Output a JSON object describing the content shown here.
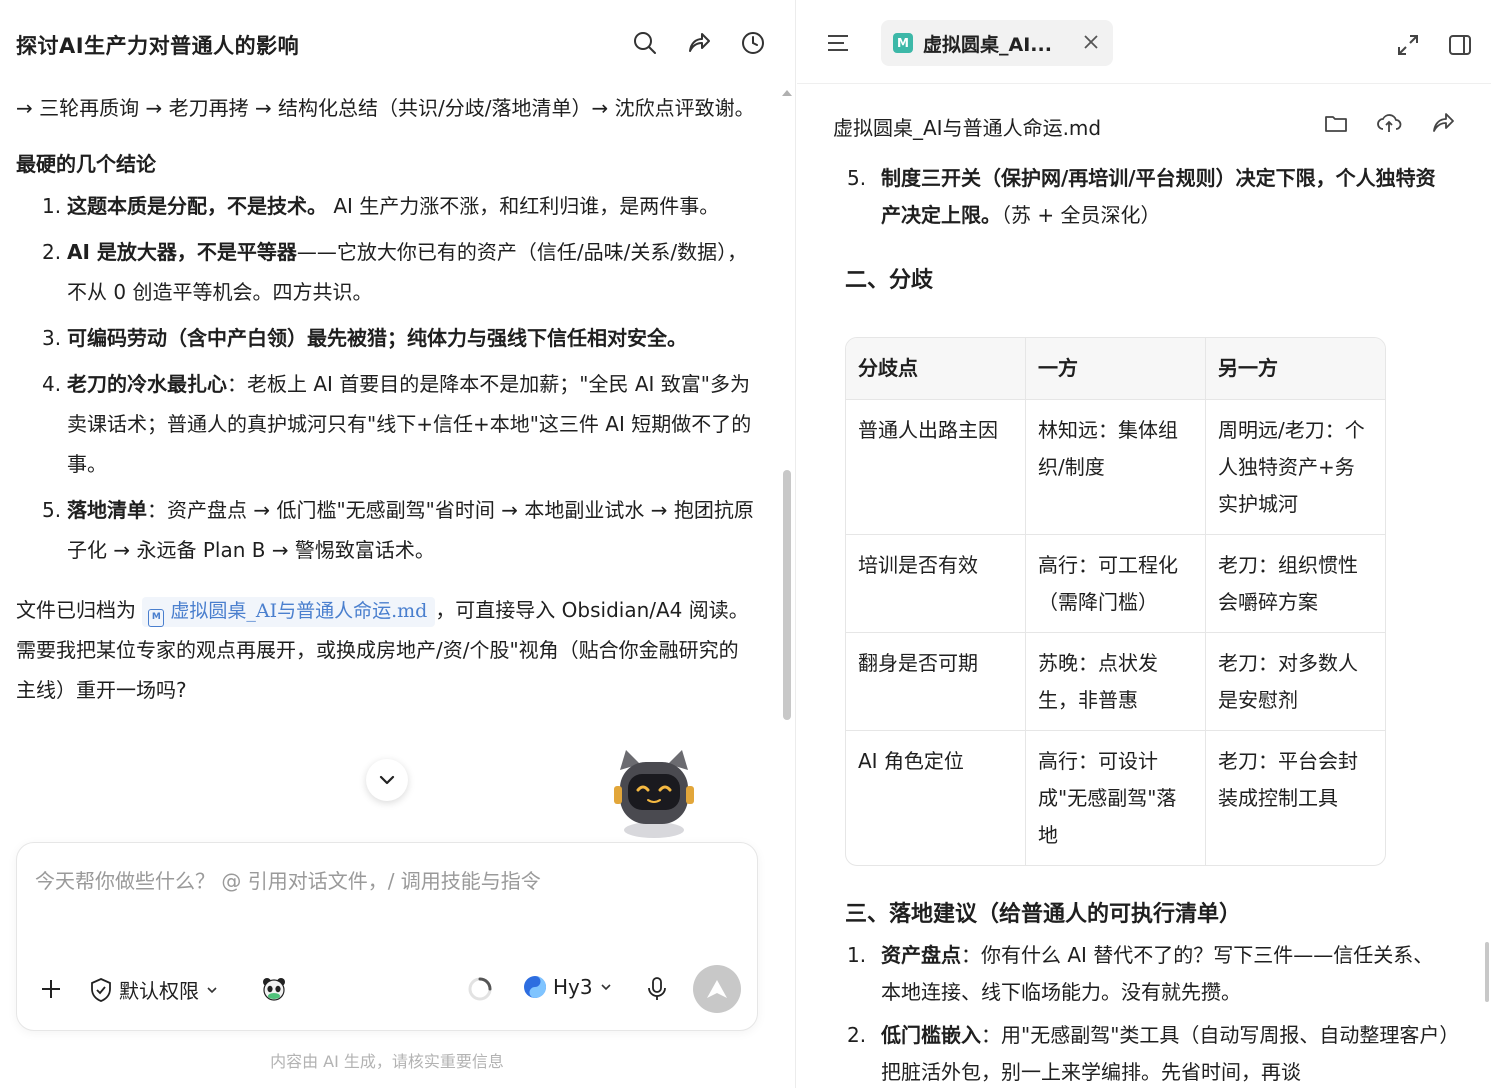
{
  "left": {
    "title": "探讨AI生产力对普通人的影响",
    "intro_text": "→ 三轮再质询 → 老刀再拷 → 结构化总结（共识/分歧/落地清单）→ 沈欣点评致谢。",
    "section_heading": "最硬的几个结论",
    "conclusions": [
      {
        "num": "1.",
        "bold": "这题本质是分配，不是技术。",
        "rest": " AI 生产力涨不涨，和红利归谁，是两件事。"
      },
      {
        "num": "2.",
        "bold": "AI 是放大器，不是平等器",
        "rest": "——它放大你已有的资产（信任/品味/关系/数据），不从 0 创造平等机会。四方共识。"
      },
      {
        "num": "3.",
        "bold": "可编码劳动（含中产白领）最先被猎；纯体力与强线下信任相对安全。",
        "rest": ""
      },
      {
        "num": "4.",
        "bold": "老刀的冷水最扎心",
        "rest": "：老板上 AI 首要目的是降本不是加薪；\"全民 AI 致富\"多为卖课话术；普通人的真护城河只有\"线下+信任+本地\"这三件 AI 短期做不了的事。"
      },
      {
        "num": "5.",
        "bold": "落地清单",
        "rest": "：资产盘点 → 低门槛\"无感副驾\"省时间 → 本地副业试水 → 抱团抗原子化 → 永远备 Plan B → 警惕致富话术。"
      }
    ],
    "archive_prefix": "文件已归档为",
    "archive_file": "虚拟圆桌_AI与普通人命运.md",
    "archive_suffix": "，可直接导入 Obsidian/A4 阅读。需要我把某位专家的观点再展开，或换成房地产/资/个股\"视角（贴合你金融研究的主线）重开一场吗?",
    "composer": {
      "placeholder": "今天帮你做些什么？ @ 引用对话文件，/ 调用技能与指令",
      "permission_label": "默认权限",
      "model_label": "Hy3"
    },
    "disclaimer": "内容由 AI 生成，请核实重要信息"
  },
  "right": {
    "tab_label": "虚拟圆桌_AI...",
    "doc_title": "虚拟圆桌_AI与普通人命运.md",
    "item5": {
      "num": "5.",
      "bold": "制度三开关（保护网/再培训/平台规则）决定下限，个人独特资产决定上限。",
      "rest": "（苏 + 全员深化）"
    },
    "section2": "二、分歧",
    "table": {
      "headers": [
        "分歧点",
        "一方",
        "另一方"
      ],
      "rows": [
        [
          "普通人出路主因",
          "林知远：集体组织/制度",
          "周明远/老刀：个人独特资产+务实护城河"
        ],
        [
          "培训是否有效",
          "高行：可工程化（需降门槛）",
          "老刀：组织惯性会嚼碎方案"
        ],
        [
          "翻身是否可期",
          "苏晚：点状发生，非普惠",
          "老刀：对多数人是安慰剂"
        ],
        [
          "AI 角色定位",
          "高行：可设计成\"无感副驾\"落地",
          "老刀：平台会封装成控制工具"
        ]
      ]
    },
    "section3": "三、落地建议（给普通人的可执行清单）",
    "actions": [
      {
        "num": "1.",
        "bold": "资产盘点",
        "rest": "：你有什么 AI 替代不了的？写下三件——信任关系、本地连接、线下临场能力。没有就先攒。"
      },
      {
        "num": "2.",
        "bold": "低门槛嵌入",
        "rest": "：用\"无感副驾\"类工具（自动写周报、自动整理客户）把脏活外包，别一上来学编排。先省时间，再谈"
      }
    ]
  }
}
